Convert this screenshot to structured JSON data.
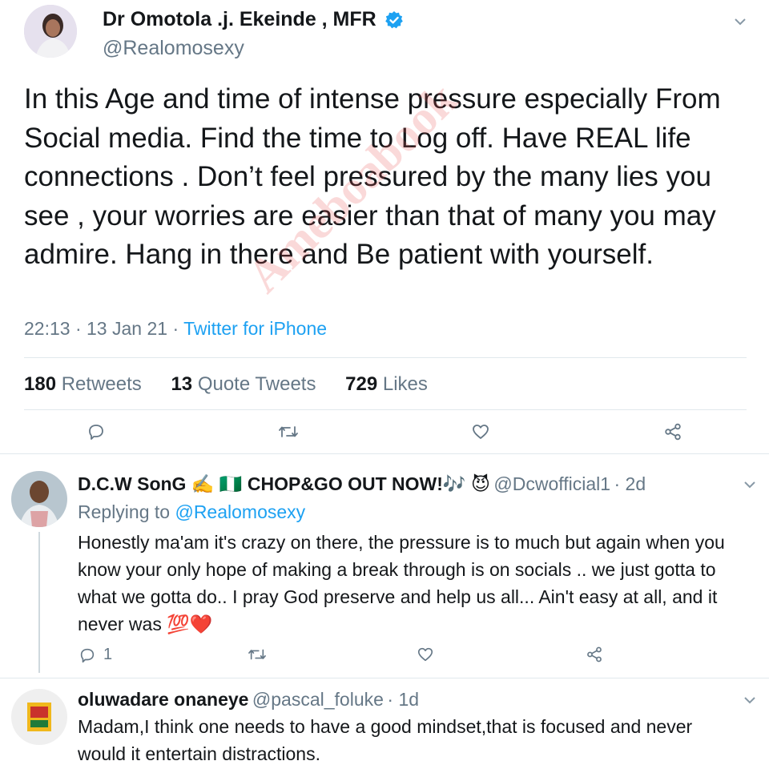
{
  "main_tweet": {
    "author_name": "Dr Omotola .j. Ekeinde , MFR",
    "handle": "@Realomosexy",
    "text": "In this Age and time of intense pressure especially From Social media. Find the time to Log off. Have REAL life connections . Don’t feel pressured by the many lies you see , your worries are easier than that of many you may admire. Hang in there and Be patient with yourself.",
    "time": "22:13",
    "date": "13 Jan 21",
    "source": "Twitter for iPhone",
    "retweets_count": "180",
    "retweets_label": "Retweets",
    "quotes_count": "13",
    "quotes_label": "Quote Tweets",
    "likes_count": "729",
    "likes_label": "Likes"
  },
  "replies": [
    {
      "author_name": "D.C.W SonG ✍️ 🇳🇬 CHOP&GO OUT NOW!🎶 😈",
      "handle": "@Dcwofficial1",
      "age": "2d",
      "replying_prefix": "Replying to",
      "replying_to": "@Realomosexy",
      "text": "Honestly ma'am it's crazy on there, the pressure is to much but again when you know your only hope of making a break through is on socials .. we just gotta to what we gotta do.. I pray God preserve and help us all... Ain't easy at all, and it never was 💯❤️",
      "reply_count": "1"
    },
    {
      "author_name": "oluwadare onaneye",
      "handle": "@pascal_foluke",
      "age": "1d",
      "text": "Madam,I think one needs to have a good mindset,that is focused and never would it entertain distractions."
    }
  ],
  "watermark": "Ameboabook",
  "colors": {
    "accent": "#1da1f2",
    "muted": "#657786",
    "text": "#14171a",
    "like_heart": "#e0245e"
  }
}
